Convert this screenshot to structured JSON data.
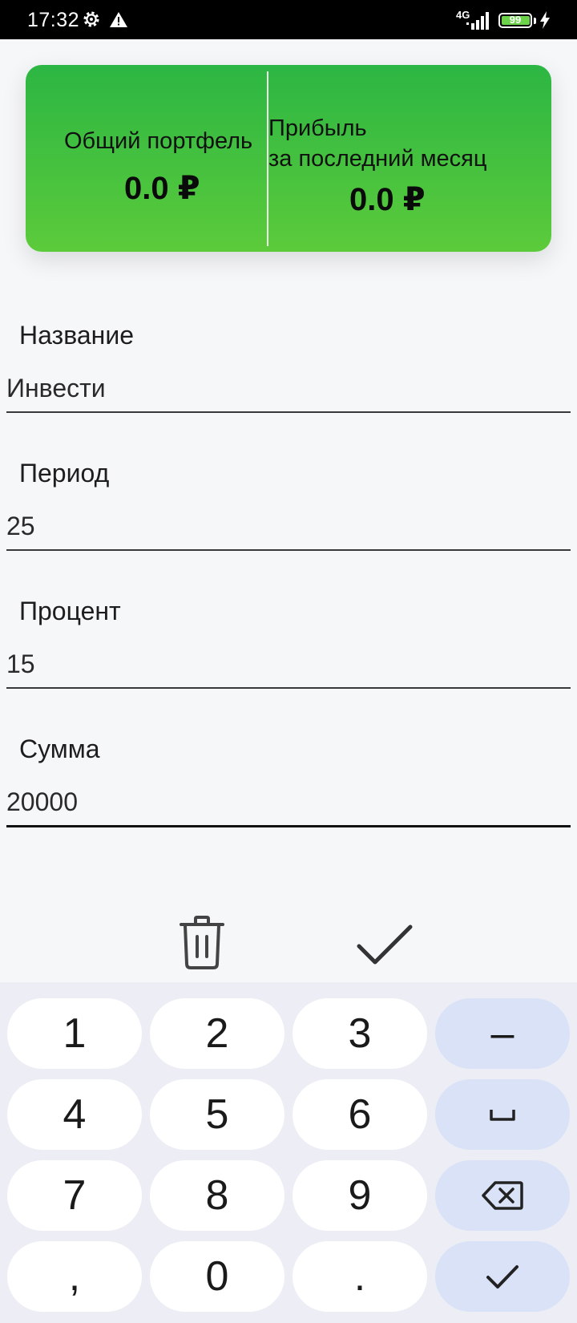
{
  "status_bar": {
    "time": "17:32",
    "network": "4G",
    "battery": "99",
    "icons": [
      "gear-icon",
      "warning-icon",
      "signal-icon",
      "battery-icon",
      "charging-icon"
    ]
  },
  "summary": {
    "portfolio_label": "Общий портфель",
    "portfolio_value": "0.0 ₽",
    "profit_label_line1": "Прибыль",
    "profit_label_line2": "за последний месяц",
    "profit_value": "0.0 ₽"
  },
  "form": {
    "name_label": "Название",
    "name_value": "Инвести",
    "period_label": "Период",
    "period_value": "25",
    "percent_label": "Процент",
    "percent_value": "15",
    "amount_label": "Сумма",
    "amount_value": "20000"
  },
  "actions": {
    "icons": [
      "trash-icon",
      "check-icon"
    ]
  },
  "keyboard": {
    "digits": [
      "1",
      "2",
      "3",
      "4",
      "5",
      "6",
      "7",
      "8",
      "9",
      ",",
      "0",
      "."
    ],
    "minus": "–",
    "icons": [
      "space-icon",
      "backspace-icon",
      "enter-check-icon"
    ]
  },
  "colors": {
    "card_gradient_top": "#2cb643",
    "card_gradient_bottom": "#5ccb3b",
    "background": "#f6f7f9",
    "keyboard_bg": "#edeef5",
    "func_key": "#d9e2f7"
  }
}
